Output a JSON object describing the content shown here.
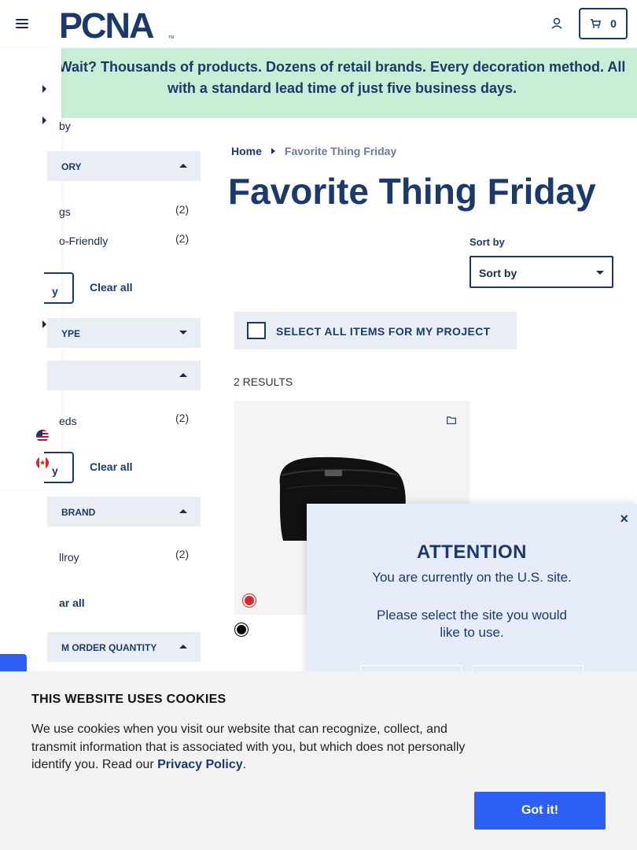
{
  "header": {
    "logo_text": "PCNA",
    "logo_tm": "TM",
    "cart_count": "0",
    "icons": [
      "hamburger-icon",
      "user-icon",
      "cart-icon"
    ]
  },
  "promo": {
    "text": "Wait? Thousands of products. Dozens of retail brands. Every decoration method. All with a standard lead time of just five business days."
  },
  "sidebar": {
    "partial_label_top": "by",
    "sections": [
      {
        "label": "ORY",
        "state": "expanded",
        "items": [
          {
            "label": "gs",
            "count": "(2)"
          },
          {
            "label": "o-Friendly",
            "count": "(2)"
          }
        ],
        "apply_label": "y",
        "clear_label": "Clear all"
      },
      {
        "label": "YPE",
        "state": "collapsed"
      },
      {
        "label": "",
        "state": "expanded",
        "items": [
          {
            "label": "eds",
            "count": "(2)"
          }
        ],
        "apply_label": "y",
        "clear_label": "Clear all"
      },
      {
        "label": "BRAND",
        "state": "expanded",
        "items": [
          {
            "label": "llroy",
            "count": "(2)"
          }
        ],
        "clear_label": "ar all"
      },
      {
        "label": "M ORDER QUANTITY",
        "state": "expanded"
      }
    ]
  },
  "main": {
    "breadcrumb": {
      "home": "Home",
      "current": "Favorite Thing Friday"
    },
    "title": "Favorite Thing Friday",
    "sort": {
      "label": "Sort by",
      "value": "Sort by"
    },
    "select_all_label": "SELECT ALL ITEMS FOR MY PROJECT",
    "results_label": "2 RESULTS",
    "product": {
      "swatch_colors": [
        "#d62a2a",
        "#000000"
      ]
    }
  },
  "modal": {
    "close": "×",
    "title": "ATTENTION",
    "line1": "You are currently on the U.S. site.",
    "line2a": "Please select the site you would",
    "line2b": "like to use."
  },
  "cookie": {
    "title": "THIS WEBSITE USES COOKIES",
    "text": "We use cookies when you visit our website that can recognize, collect, and transmit information that is associated with you, but which does not personally identify you. Read our ",
    "link": "Privacy Policy",
    "after": ".",
    "button": "Got it!"
  },
  "colors": {
    "navy": "#1b3a6b",
    "promo_bg": "#c8efd5",
    "filter_bg": "#e9edf4",
    "accent_blue": "#2d5ff5"
  }
}
